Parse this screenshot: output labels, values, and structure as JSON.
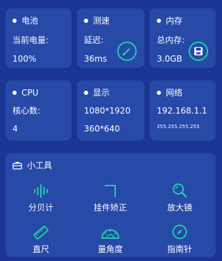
{
  "cards": {
    "battery": {
      "title": "电池",
      "label": "当前电量:",
      "value": "100%"
    },
    "speed": {
      "title": "测速",
      "label": "延迟:",
      "value": "36ms"
    },
    "memory": {
      "title": "内存",
      "label": "总内存:",
      "value": "3.0GB"
    },
    "cpu": {
      "title": "CPU",
      "label": "核心数:",
      "value": "4"
    },
    "display": {
      "title": "显示",
      "line1": "1080*1920",
      "line2": "360*640"
    },
    "network": {
      "title": "网络",
      "ip": "192.168.1.1",
      "mask": "255.255.255.255"
    }
  },
  "tools": {
    "title": "小工具",
    "items": [
      {
        "label": "分贝计",
        "icon": "decibel-icon"
      },
      {
        "label": "挂件矫正",
        "icon": "corner-icon"
      },
      {
        "label": "放大镜",
        "icon": "magnifier-icon"
      },
      {
        "label": "直尺",
        "icon": "ruler-icon"
      },
      {
        "label": "量角度",
        "icon": "protractor-icon"
      },
      {
        "label": "指南针",
        "icon": "compass-icon"
      }
    ]
  },
  "colors": {
    "background": "#1b3592",
    "card": "#2749a8",
    "accent": "#1fd0a4"
  }
}
